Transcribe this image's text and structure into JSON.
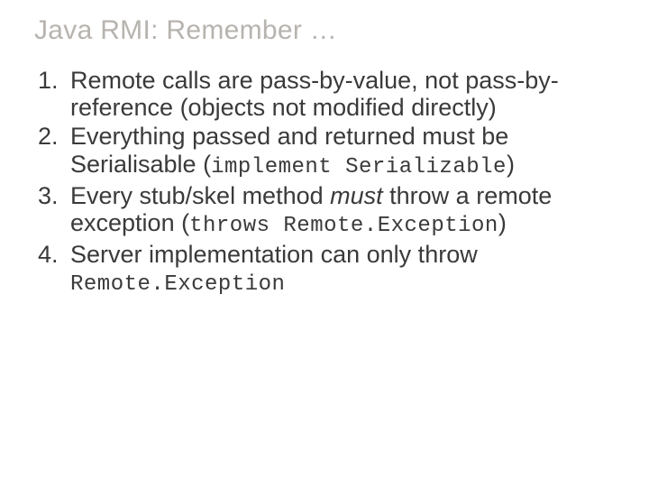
{
  "title": "Java RMI: Remember …",
  "items": {
    "i1_a": "Remote calls are pass-by-value, not pass-by-reference (objects not modified directly)",
    "i2_a": "Everything passed and returned must be Serialisable (",
    "i2_code": "implement Serializable",
    "i2_b": ")",
    "i3_a": "Every stub/skel method ",
    "i3_em": "must",
    "i3_b": " throw a remote exception (",
    "i3_code": "throws Remote.Exception",
    "i3_c": ")",
    "i4_a": "Server implementation can only throw ",
    "i4_code": "Remote.Exception"
  }
}
